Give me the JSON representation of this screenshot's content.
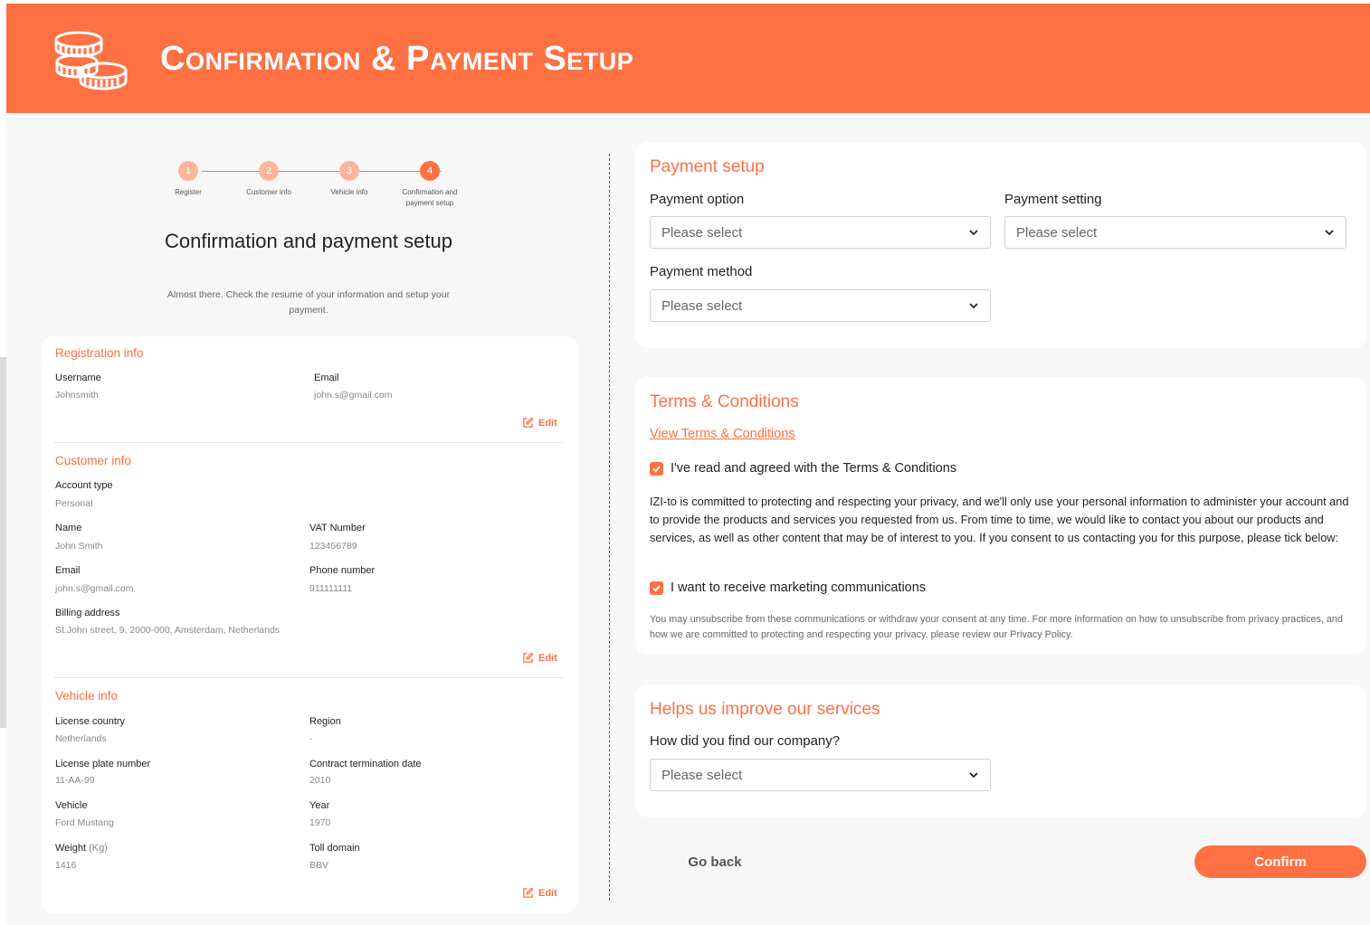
{
  "header": {
    "title": "Confirmation & Payment Setup",
    "color": "#ff7043",
    "icon": "coins-icon"
  },
  "stepper": {
    "steps": [
      {
        "number": "1",
        "label": "Register"
      },
      {
        "number": "2",
        "label": "Customer info"
      },
      {
        "number": "3",
        "label": "Vehicle info"
      },
      {
        "number": "4",
        "label": "Confirmation and payment setup"
      }
    ],
    "active_step": 4
  },
  "page": {
    "title": "Confirmation and payment setup",
    "subtitle": "Almost there. Check the resume of your information and setup your payment."
  },
  "registration": {
    "title": "Registration info",
    "username_label": "Username",
    "username_value": "Johnsmith",
    "email_label": "Email",
    "email_value": "john.s@gmail.com",
    "edit_label": "Edit"
  },
  "customer": {
    "title": "Customer info",
    "account_type_label": "Account type",
    "account_type_value": "Personal",
    "name_label": "Name",
    "name_value": "John Smith",
    "vat_label": "VAT Number",
    "vat_value": "123456789",
    "email_label": "Email",
    "email_value": "john.s@gmail.com",
    "phone_label": "Phone number",
    "phone_value": "911111111",
    "billing_label": "Billing address",
    "billing_value": "St.John street, 9, 2000-000, Amsterdam, Netherlands",
    "edit_label": "Edit"
  },
  "vehicle": {
    "title": "Vehicle info",
    "license_country_label": "License country",
    "license_country_value": "Netherlands",
    "region_label": "Region",
    "region_value": "-",
    "plate_label": "License plate number",
    "plate_value": "11-AA-99",
    "contract_label": "Contract termination date",
    "contract_value": "2010",
    "vehicle_label": "Vehicle",
    "vehicle_value": "Ford Mustang",
    "year_label": "Year",
    "year_value": "1970",
    "weight_label": "Weight",
    "weight_unit": "(Kg)",
    "weight_value": "1416",
    "toll_label": "Toll domain",
    "toll_value": "BBV",
    "edit_label": "Edit"
  },
  "payment": {
    "title": "Payment setup",
    "option_label": "Payment option",
    "option_value": "Please select",
    "setting_label": "Payment setting",
    "setting_value": "Please select",
    "method_label": "Payment method",
    "method_value": "Please select"
  },
  "terms": {
    "title": "Terms & Conditions",
    "link": "View Terms & Conditions",
    "agree_label": "I've read and agreed with the Terms & Conditions",
    "agree_checked": true,
    "privacy_text": "IZI-to is committed to protecting and respecting your privacy, and we'll only use your personal information to administer your account and to provide the products and services you requested from us. From time to time, we would like to contact you about our products and services, as well as other content that may be of interest to you. If you consent to us contacting you for this purpose, please tick below:",
    "marketing_label": "I want to receive marketing communications",
    "marketing_checked": true,
    "unsubscribe_text": "You may unsubscribe from these communications or withdraw your consent at any time. For more information on how to unsubscribe from privacy practices, and how we are committed to protecting and respecting your privacy, please review our Privacy Policy."
  },
  "improve": {
    "title": "Helps us improve our services",
    "question": "How did you find our company?",
    "value": "Please select"
  },
  "actions": {
    "back_label": "Go back",
    "confirm_label": "Confirm"
  }
}
